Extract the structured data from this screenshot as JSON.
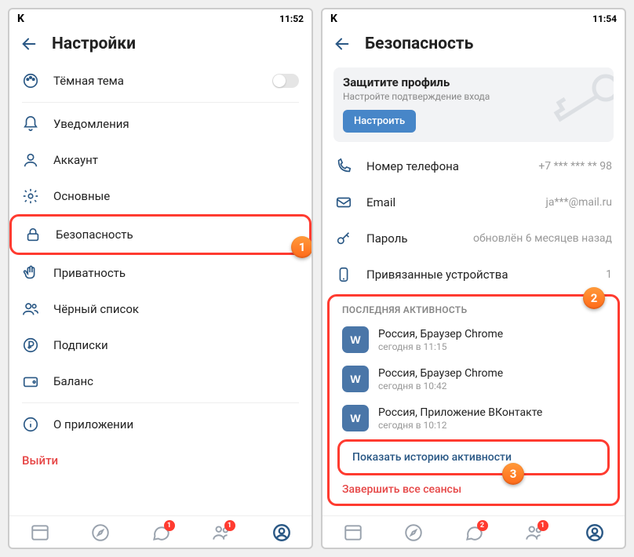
{
  "left": {
    "status": {
      "app_letter": "K",
      "time": "11:52"
    },
    "title": "Настройки",
    "dark_mode_label": "Тёмная тема",
    "items": [
      {
        "label": "Уведомления"
      },
      {
        "label": "Аккаунт"
      },
      {
        "label": "Основные"
      },
      {
        "label": "Безопасность"
      },
      {
        "label": "Приватность"
      },
      {
        "label": "Чёрный список"
      },
      {
        "label": "Подписки"
      },
      {
        "label": "Баланс"
      }
    ],
    "about_label": "О приложении",
    "logout_label": "Выйти",
    "nav_badges": {
      "messages": "1",
      "friends": "1"
    }
  },
  "right": {
    "status": {
      "app_letter": "K",
      "time": "11:54"
    },
    "title": "Безопасность",
    "protect": {
      "title": "Защитите профиль",
      "subtitle": "Настройте подтверждение входа",
      "button": "Настроить"
    },
    "fields": {
      "phone": {
        "label": "Номер телефона",
        "value": "+7 *** *** ** 98"
      },
      "email": {
        "label": "Email",
        "value": "ja***@mail.ru"
      },
      "password": {
        "label": "Пароль",
        "value": "обновлён 6 месяцев назад"
      },
      "devices": {
        "label": "Привязанные устройства",
        "value": "1"
      }
    },
    "activity_section": "ПОСЛЕДНЯЯ АКТИВНОСТЬ",
    "sessions": [
      {
        "name": "Россия, Браузер Chrome",
        "time": "сегодня в 11:15"
      },
      {
        "name": "Россия, Браузер Chrome",
        "time": "сегодня в 10:42"
      },
      {
        "name": "Россия, Приложение ВКонтакте",
        "time": "сегодня в 10:12"
      }
    ],
    "show_history": "Показать историю активности",
    "end_sessions": "Завершить все сеансы",
    "nav_badges": {
      "messages": "2",
      "friends": "1"
    }
  },
  "steps": {
    "s1": "1",
    "s2": "2",
    "s3": "3"
  }
}
